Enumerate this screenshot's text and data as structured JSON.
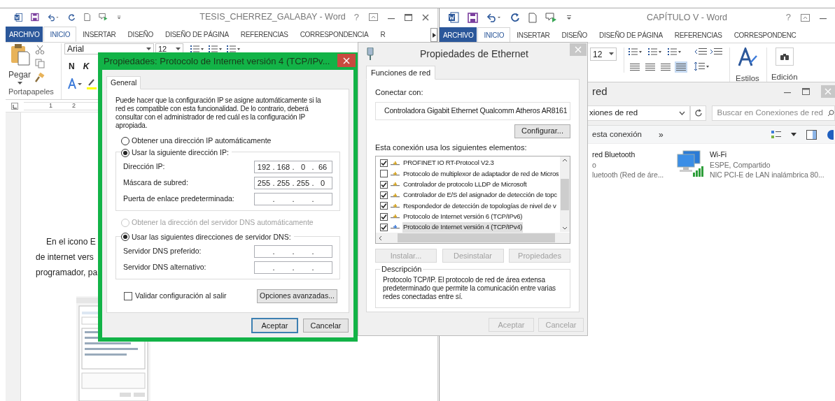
{
  "word_left": {
    "title": "TESIS_CHERREZ_GALABAY - Word",
    "help": "?",
    "tabs": [
      {
        "label": "ARCHIVO",
        "kind": "file",
        "selected": false
      },
      {
        "label": "INICIO",
        "kind": "tab",
        "selected": true
      },
      {
        "label": "INSERTAR",
        "kind": "tab",
        "selected": false
      },
      {
        "label": "DISEÑO",
        "kind": "tab",
        "selected": false
      },
      {
        "label": "DISEÑO DE PÁGINA",
        "kind": "tab",
        "selected": false
      },
      {
        "label": "REFERENCIAS",
        "kind": "tab",
        "selected": false
      },
      {
        "label": "CORRESPONDENCIA",
        "kind": "tab",
        "selected": false
      },
      {
        "label": "R",
        "kind": "tab",
        "selected": false
      }
    ],
    "paste": "Pegar",
    "font": "Arial",
    "size": "12",
    "bold": "N",
    "italic": "K",
    "group": "Portapapeles",
    "ruler": [
      "1",
      "2"
    ],
    "body": [
      "En el icono E",
      "de internet vers",
      "programador, pa"
    ]
  },
  "word_right": {
    "title": "CAPÍTULO V - Word",
    "help": "?",
    "tabs": [
      {
        "label": "ARCHIVO",
        "kind": "file",
        "selected": false
      },
      {
        "label": "INICIO",
        "kind": "tab",
        "selected": true
      },
      {
        "label": "INSERTAR",
        "kind": "tab",
        "selected": false
      },
      {
        "label": "DISEÑO",
        "kind": "tab",
        "selected": false
      },
      {
        "label": "DISEÑO DE PÁGINA",
        "kind": "tab",
        "selected": false
      },
      {
        "label": "REFERENCIAS",
        "kind": "tab",
        "selected": false
      },
      {
        "label": "CORRESPONDENC",
        "kind": "tab",
        "selected": false
      }
    ],
    "size": "12",
    "styles": "Estilos",
    "editing": "Edición"
  },
  "network_window": {
    "title": "red",
    "address": "xiones de red",
    "search": {
      "placeholder": "Buscar en Conexiones de red"
    },
    "command": "esta conexión",
    "more": "»",
    "items": [
      {
        "kind": "bluetooth",
        "lines": [
          "red Bluetooth",
          "o",
          "luetooth (Red de áre..."
        ]
      },
      {
        "kind": "wifi",
        "lines": [
          "Wi-Fi",
          "ESPE, Compartido",
          "NIC PCI-E de LAN inalámbrica 80..."
        ]
      }
    ]
  },
  "ethernet_dialog": {
    "title": "Propiedades de Ethernet",
    "tab": "Funciones de red",
    "connect_label": "Conectar con:",
    "adapter": "Controladora Gigabit Ethernet Qualcomm Atheros AR8161",
    "configure": "Configurar...",
    "items_label": "Esta conexión usa los siguientes elementos:",
    "items": [
      {
        "label": "PROFINET IO RT-Protocol V2.3",
        "checked": true,
        "selected": false
      },
      {
        "label": "Protocolo de multiplexor de adaptador de red de Micros",
        "checked": false,
        "selected": false
      },
      {
        "label": "Controlador de protocolo LLDP de Microsoft",
        "checked": true,
        "selected": false
      },
      {
        "label": "Controlador de E/S del asignador de detección de topc",
        "checked": true,
        "selected": false
      },
      {
        "label": "Respondedor de detección de topologías de nivel de v",
        "checked": true,
        "selected": false
      },
      {
        "label": "Protocolo de Internet versión 6 (TCP/IPv6)",
        "checked": true,
        "selected": false
      },
      {
        "label": "Protocolo de Internet versión 4 (TCP/IPv4)",
        "checked": true,
        "selected": true
      }
    ],
    "actions": [
      {
        "label": "Instalar...",
        "disabled": true
      },
      {
        "label": "Desinstalar",
        "disabled": true
      },
      {
        "label": "Propiedades",
        "disabled": true
      }
    ],
    "description_label": "Descripción",
    "description": "Protocolo TCP/IP. El protocolo de red de área extensa predeterminado que permite la comunicación entre varias redes conectadas entre sí.",
    "buttons": [
      {
        "label": "Aceptar",
        "disabled": true
      },
      {
        "label": "Cancelar",
        "disabled": true
      }
    ]
  },
  "ipv4_dialog": {
    "title": "Propiedades: Protocolo de Internet versión 4 (TCP/IPv...",
    "tab": "General",
    "intro": "Puede hacer que la configuración IP se asigne automáticamente si la red es compatible con esta funcionalidad. De lo contrario, deberá consultar con el administrador de red cuál es la configuración IP apropiada.",
    "separator": ".",
    "auto_ip": {
      "label": "Obtener una dirección IP automáticamente",
      "selected": false,
      "disabled": false
    },
    "manual_ip": {
      "label": "Usar la siguiente dirección IP:",
      "selected": true,
      "disabled": false,
      "fields": [
        {
          "label": "Dirección IP:",
          "octets": [
            "192",
            "168",
            "0",
            "66"
          ]
        },
        {
          "label": "Máscara de subred:",
          "octets": [
            "255",
            "255",
            "255",
            "0"
          ]
        },
        {
          "label": "Puerta de enlace predeterminada:"
        }
      ]
    },
    "auto_dns": {
      "label": "Obtener la dirección del servidor DNS automáticamente",
      "selected": false,
      "disabled": true
    },
    "manual_dns": {
      "label": "Usar las siguientes direcciones de servidor DNS:",
      "selected": true,
      "disabled": false,
      "fields": [
        {
          "label": "Servidor DNS preferido:"
        },
        {
          "label": "Servidor DNS alternativo:"
        }
      ]
    },
    "validate": {
      "label": "Validar configuración al salir",
      "checked": false
    },
    "advanced": "Opciones avanzadas...",
    "buttons": [
      {
        "label": "Aceptar",
        "default": true
      },
      {
        "label": "Cancelar",
        "default": false
      }
    ]
  }
}
